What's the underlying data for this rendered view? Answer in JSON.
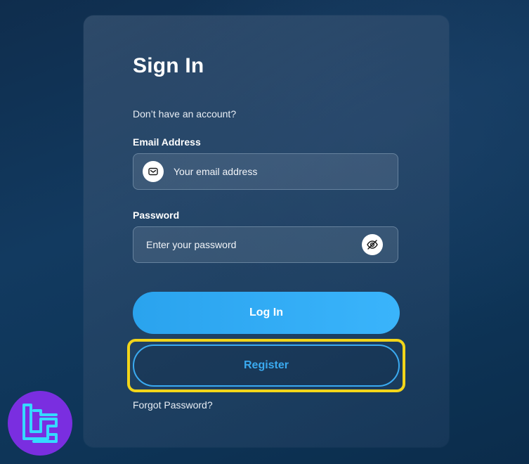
{
  "signin": {
    "title": "Sign In",
    "no_account_text": "Don’t have an account?",
    "email": {
      "label": "Email Address",
      "placeholder": "Your email address",
      "value": ""
    },
    "password": {
      "label": "Password",
      "placeholder": "Enter your password",
      "value": ""
    },
    "login_label": "Log In",
    "register_label": "Register",
    "forgot_label": "Forgot Password?"
  },
  "icons": {
    "email": "mail-icon",
    "password_toggle": "eye-slash-icon",
    "logo": "tradingfinder-logo"
  },
  "colors": {
    "accent": "#2aa3ee",
    "highlight": "#f2d51a",
    "logo_bg": "#7a2ee0",
    "logo_fg": "#35d9ff"
  }
}
